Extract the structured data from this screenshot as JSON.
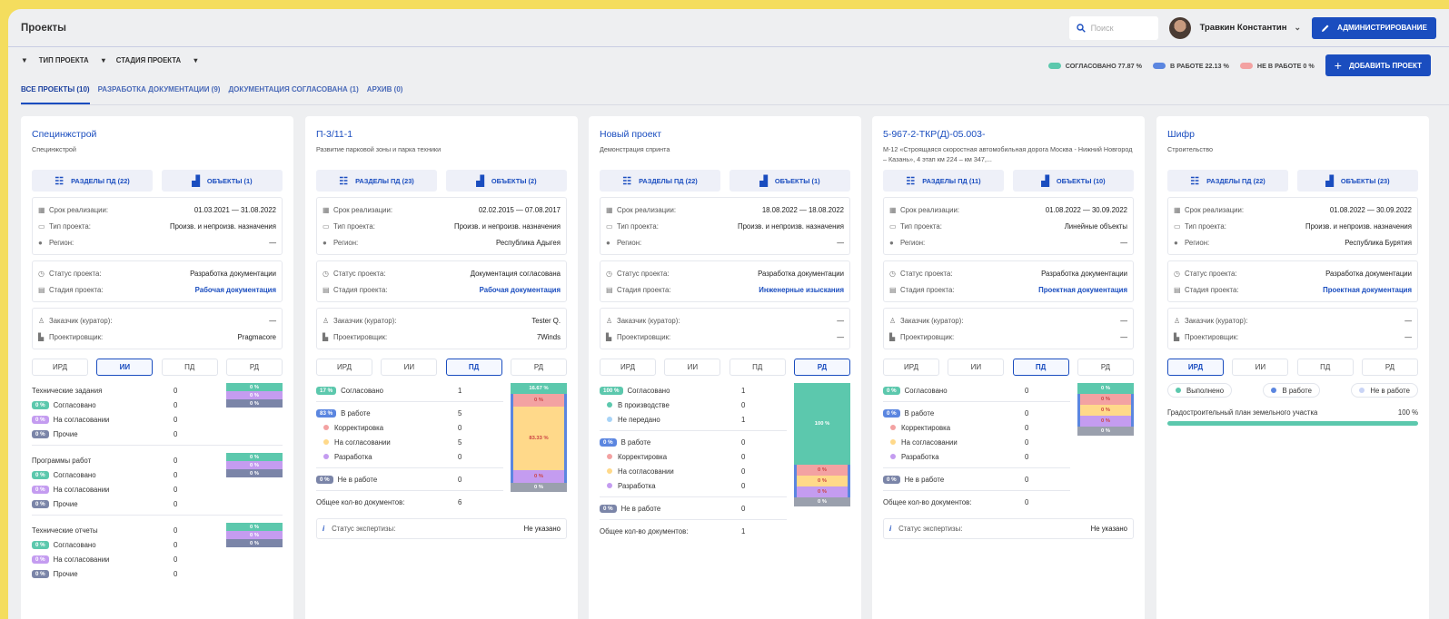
{
  "header": {
    "title": "Проекты",
    "search_placeholder": "Поиск",
    "user_name": "Травкин Константин",
    "admin_label": "АДМИНИСТРИРОВАНИЕ"
  },
  "filters": {
    "type": "ТИП ПРОЕКТА",
    "stage": "СТАДИЯ ПРОЕКТА"
  },
  "legend": {
    "agreed": "СОГЛАСОВАНО 77.87 %",
    "in_work": "В РАБОТЕ 22.13 %",
    "not_in_work": "НЕ В РАБОТЕ 0 %",
    "add": "ДОБАВИТЬ ПРОЕКТ",
    "colors": {
      "agreed": "#5cc8ad",
      "in_work": "#5b86e0",
      "not_in_work": "#f3a2a2"
    }
  },
  "tabs": [
    "ВСЕ ПРОЕКТЫ (10)",
    "РАЗРАБОТКА ДОКУМЕНТАЦИИ (9)",
    "ДОКУМЕНТАЦИЯ СОГЛАСОВАНА (1)",
    "АРХИВ (0)"
  ],
  "labels": {
    "deadline": "Срок реализации:",
    "ptype": "Тип проекта:",
    "region": "Регион:",
    "status": "Статус проекта:",
    "stage": "Стадия проекта:",
    "customer": "Заказчик (куратор):",
    "designer": "Проектировщик:",
    "total": "Общее кол-во документов:",
    "expert": "Статус экспертизы:",
    "seg": [
      "ИРД",
      "ИИ",
      "ПД",
      "РД"
    ]
  },
  "cards": [
    {
      "title": "Специнжстрой",
      "desc": "Специнжстрой",
      "sections": "РАЗДЕЛЫ ПД (22)",
      "objects": "ОБЪЕКТЫ (1)",
      "deadline": "01.03.2021 — 31.08.2022",
      "ptype": "Произв. и непроизв. назначения",
      "region": "—",
      "status": "Разработка документации",
      "stage": "Рабочая документация",
      "customer": "—",
      "designer": "Pragmacore",
      "groups": [
        {
          "name": "Технические задания",
          "count": "0",
          "items": [
            [
              "0 %",
              "Согласовано",
              "0"
            ],
            [
              "0 %",
              "На согласовании",
              "0"
            ],
            [
              "0 %",
              "Прочие",
              "0"
            ]
          ],
          "bar": [
            "0 %",
            "0 %",
            "0 %"
          ]
        },
        {
          "name": "Программы работ",
          "count": "0",
          "items": [
            [
              "0 %",
              "Согласовано",
              "0"
            ],
            [
              "0 %",
              "На согласовании",
              "0"
            ],
            [
              "0 %",
              "Прочие",
              "0"
            ]
          ],
          "bar": [
            "0 %",
            "0 %",
            "0 %"
          ]
        },
        {
          "name": "Технические отчеты",
          "count": "0",
          "items": [
            [
              "0 %",
              "Согласовано",
              "0"
            ],
            [
              "0 %",
              "На согласовании",
              "0"
            ],
            [
              "0 %",
              "Прочие",
              "0"
            ]
          ],
          "bar": [
            "0 %",
            "0 %",
            "0 %"
          ]
        }
      ]
    },
    {
      "title": "П-3/11-1",
      "desc": "Развитие парковой зоны и парка техники",
      "sections": "РАЗДЕЛЫ ПД (23)",
      "objects": "ОБЪЕКТЫ (2)",
      "deadline": "02.02.2015 — 07.08.2017",
      "ptype": "Произв. и непроизв. назначения",
      "region": "Республика Адыгея",
      "status": "Документация согласована",
      "stage": "Рабочая документация",
      "customer": "Tester Q.",
      "designer": "7Winds",
      "b_agreed": "17 %",
      "agreed": "Согласовано",
      "agreed_n": "1",
      "b_work": "83 %",
      "work": "В работе",
      "work_n": "5",
      "sub": [
        [
          "Корректировка",
          "0"
        ],
        [
          "На согласовании",
          "5"
        ],
        [
          "Разработка",
          "0"
        ]
      ],
      "b_not": "0 %",
      "not": "Не в работе",
      "not_n": "0",
      "total_n": "6",
      "expert_v": "Не указано",
      "bar": [
        "16.67 %",
        "0 %",
        "83.33 %",
        "0 %",
        "0 %"
      ]
    },
    {
      "title": "Новый проект",
      "desc": "Демонстрация спринта",
      "sections": "РАЗДЕЛЫ ПД (22)",
      "objects": "ОБЪЕКТЫ (1)",
      "deadline": "18.08.2022 — 18.08.2022",
      "ptype": "Произв. и непроизв. назначения",
      "region": "—",
      "status": "Разработка документации",
      "stage": "Инженерные изыскания",
      "customer": "—",
      "designer": "—",
      "b_agreed": "100 %",
      "agreed": "Согласовано",
      "agreed_n": "1",
      "agreed_sub": [
        [
          "В производстве",
          "0"
        ],
        [
          "Не передано",
          "1"
        ]
      ],
      "b_work": "0 %",
      "work": "В работе",
      "work_n": "0",
      "sub": [
        [
          "Корректировка",
          "0"
        ],
        [
          "На согласовании",
          "0"
        ],
        [
          "Разработка",
          "0"
        ]
      ],
      "b_not": "0 %",
      "not": "Не в работе",
      "not_n": "0",
      "total_n": "1",
      "bar": [
        "100 %",
        "0 %",
        "0 %",
        "0 %",
        "0 %"
      ]
    },
    {
      "title": "5-967-2-ТКР(Д)-05.003-",
      "desc": "М-12 «Строящаяся скоростная автомобильная дорога Москва - Нижний Новгород – Казань», 4 этап км 224 – км 347,...",
      "sections": "РАЗДЕЛЫ ПД (11)",
      "objects": "ОБЪЕКТЫ (10)",
      "deadline": "01.08.2022 — 30.09.2022",
      "ptype": "Линейные объекты",
      "region": "—",
      "status": "Разработка документации",
      "stage": "Проектная документация",
      "customer": "—",
      "designer": "—",
      "b_agreed": "0 %",
      "agreed": "Согласовано",
      "agreed_n": "0",
      "b_work": "0 %",
      "work": "В работе",
      "work_n": "0",
      "sub": [
        [
          "Корректировка",
          "0"
        ],
        [
          "На согласовании",
          "0"
        ],
        [
          "Разработка",
          "0"
        ]
      ],
      "b_not": "0 %",
      "not": "Не в работе",
      "not_n": "0",
      "total_n": "0",
      "expert_v": "Не указано",
      "bar": [
        "0 %",
        "0 %",
        "0 %",
        "0 %",
        "0 %"
      ]
    },
    {
      "title": "Шифр",
      "desc": "Строительство",
      "sections": "РАЗДЕЛЫ ПД (22)",
      "objects": "ОБЪЕКТЫ (23)",
      "deadline": "01.08.2022 — 30.09.2022",
      "ptype": "Произв. и непроизв. назначения",
      "region": "Республика Бурятия",
      "status": "Разработка документации",
      "stage": "Проектная документация",
      "customer": "—",
      "designer": "—",
      "chips": [
        "Выполнено",
        "В работе",
        "Не в работе"
      ],
      "plan": "Градостроительный план земельного участка",
      "plan_v": "100 %"
    }
  ]
}
